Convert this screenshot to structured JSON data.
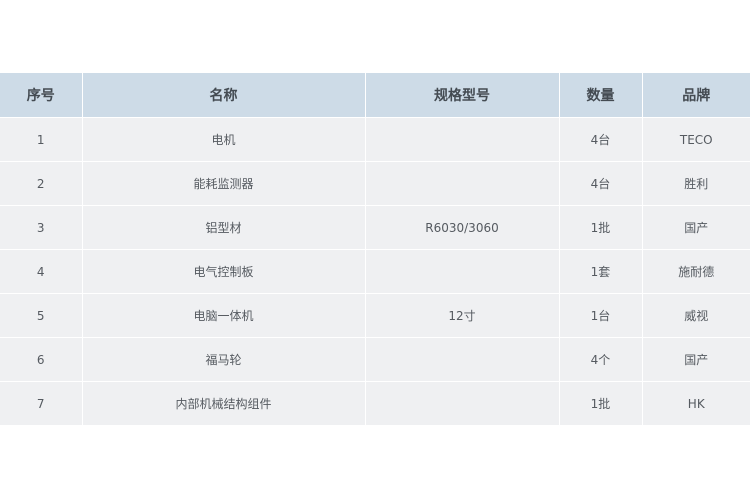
{
  "table": {
    "headers": [
      "序号",
      "名称",
      "规格型号",
      "数量",
      "品牌"
    ],
    "rows": [
      [
        "1",
        "电机",
        "",
        "4台",
        "TECO"
      ],
      [
        "2",
        "能耗监测器",
        "",
        "4台",
        "胜利"
      ],
      [
        "3",
        "铝型材",
        "R6030/3060",
        "1批",
        "国产"
      ],
      [
        "4",
        "电气控制板",
        "",
        "1套",
        "施耐德"
      ],
      [
        "5",
        "电脑一体机",
        "12寸",
        "1台",
        "威视"
      ],
      [
        "6",
        "福马轮",
        "",
        "4个",
        "国产"
      ],
      [
        "7",
        "内部机械结构组件",
        "",
        "1批",
        "HK"
      ]
    ]
  },
  "colors": {
    "header_bg": "#cddbe7",
    "row_bg": "#eff0f2"
  }
}
